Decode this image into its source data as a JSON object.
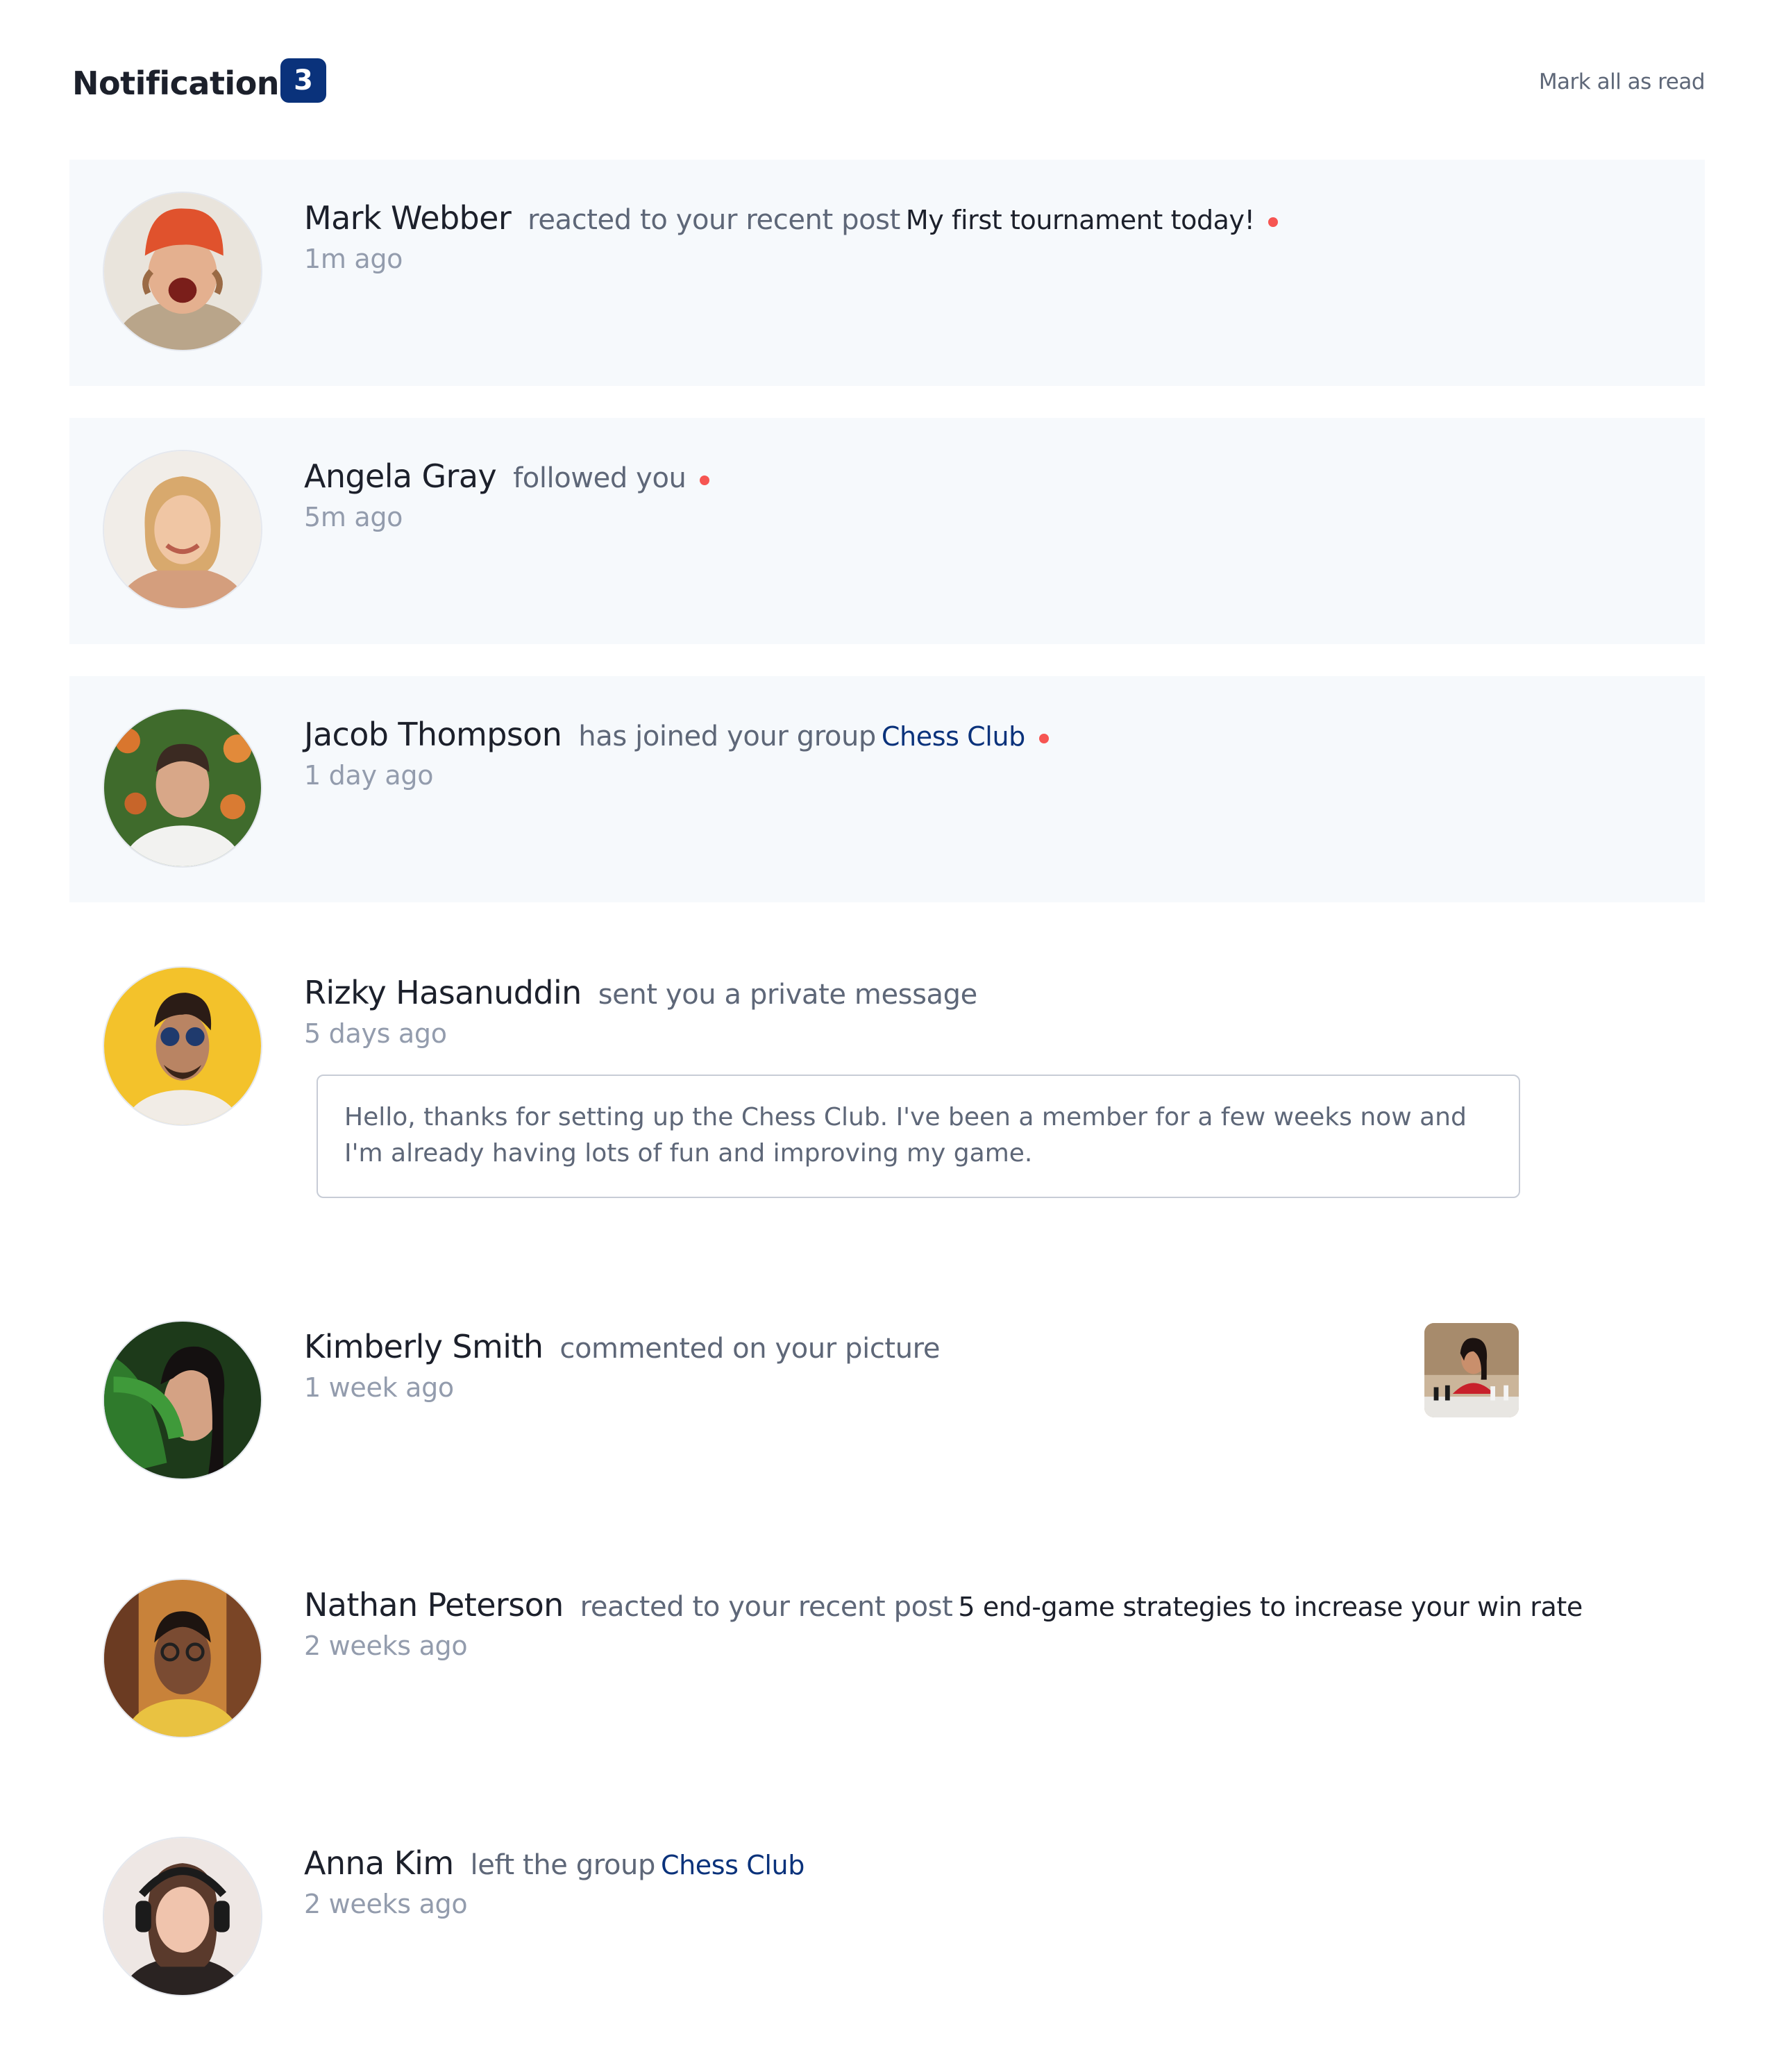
{
  "header": {
    "title": "Notifications",
    "unread_count": "3",
    "mark_all_label": "Mark all as read"
  },
  "colors": {
    "accent": "#0a327b",
    "unread_dot": "#f65552",
    "unread_background": "#f6f9fc",
    "muted_text": "#5e6778",
    "time_text": "#939cad"
  },
  "notifications": [
    {
      "name": "Mark Webber",
      "action": "reacted to your recent post",
      "post": "My first tournament today!",
      "time": "1m ago",
      "unread": true
    },
    {
      "name": "Angela Gray",
      "action": "followed you",
      "time": "5m ago",
      "unread": true
    },
    {
      "name": "Jacob Thompson",
      "action": "has joined your group",
      "group": "Chess Club",
      "time": "1 day ago",
      "unread": true
    },
    {
      "name": "Rizky Hasanuddin",
      "action": "sent you a private message",
      "time": "5 days ago",
      "message": "Hello, thanks for setting up the Chess Club. I've been a member for a few weeks now and I'm already having lots of fun and improving my game.",
      "unread": false
    },
    {
      "name": "Kimberly Smith",
      "action": "commented on your picture",
      "time": "1 week ago",
      "unread": false
    },
    {
      "name": "Nathan Peterson",
      "action": "reacted to your recent post",
      "post": "5 end-game strategies to increase your win rate",
      "time": "2 weeks ago",
      "unread": false
    },
    {
      "name": "Anna Kim",
      "action": "left the group",
      "group": "Chess Club",
      "time": "2 weeks ago",
      "unread": false
    }
  ]
}
